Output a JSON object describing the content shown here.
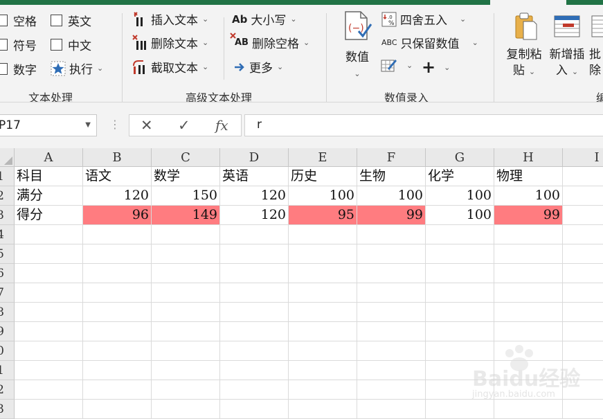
{
  "ribbon": {
    "groups": {
      "text_processing": "文本处理",
      "advanced_text": "高级文本处理",
      "numeric_entry": "数值录入"
    },
    "checkboxes": [
      "空格",
      "英文",
      "符号",
      "中文",
      "数字"
    ],
    "execute_label": "执行",
    "insert_text": "插入文本",
    "delete_text": "删除文本",
    "extract_text": "截取文本",
    "case_label": "大小写",
    "case_icon_text": "Ab",
    "delete_spaces": "删除空格",
    "delete_spaces_icon_text": "AB",
    "more_label": "更多",
    "numeric_label": "数值",
    "round_label": "四舍五入",
    "keep_numeric": "只保留数值",
    "keep_numeric_icon_text": "ABC",
    "copy_paste": [
      "复制粘",
      "贴"
    ],
    "new_insert": [
      "新增插",
      "入"
    ],
    "batch_partial": [
      "批",
      "除"
    ],
    "edit_group_partial": "编"
  },
  "formula_bar": {
    "name_box": "P17",
    "formula": "r"
  },
  "sheet": {
    "columns": [
      "A",
      "B",
      "C",
      "D",
      "E",
      "F",
      "G",
      "H",
      "I"
    ],
    "row_numbers": [
      "1",
      "2",
      "3",
      "4",
      "5",
      "6",
      "7",
      "8",
      "9",
      "10",
      "11",
      "12",
      "13"
    ],
    "rows": [
      [
        "科目",
        "语文",
        "数学",
        "英语",
        "历史",
        "生物",
        "化学",
        "物理",
        ""
      ],
      [
        "满分",
        "120",
        "150",
        "120",
        "100",
        "100",
        "100",
        "100",
        ""
      ],
      [
        "得分",
        "96",
        "149",
        "120",
        "95",
        "99",
        "100",
        "99",
        ""
      ]
    ],
    "highlight_color": "#ff7c80"
  },
  "watermark": {
    "text": "Baidu经验",
    "subtext": "jingyan.baidu.com"
  },
  "colors": {
    "accent": "#217346",
    "ribbon_bg": "#f3f3f3",
    "red_icon": "#c0392b",
    "blue_icon": "#2f6db5"
  }
}
